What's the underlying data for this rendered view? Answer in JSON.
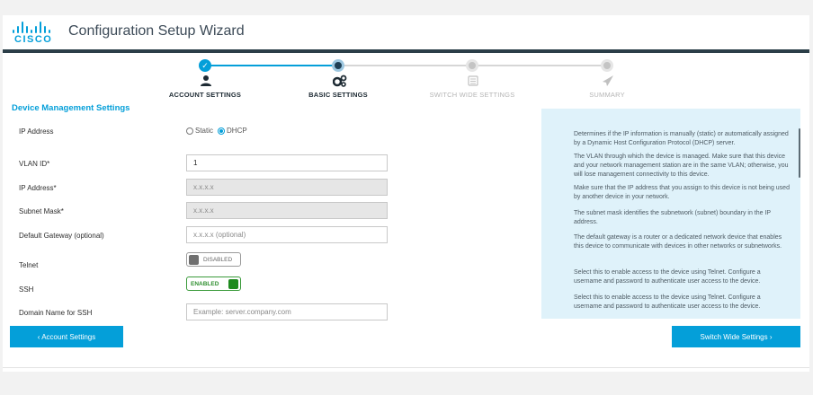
{
  "header": {
    "brand": "CISCO",
    "title": "Configuration Setup Wizard"
  },
  "steps": [
    {
      "label": "ACCOUNT SETTINGS",
      "state": "done",
      "icon": "user-icon"
    },
    {
      "label": "BASIC SETTINGS",
      "state": "current",
      "icon": "gears-icon"
    },
    {
      "label": "SWITCH WIDE SETTINGS",
      "state": "todo",
      "icon": "switch-icon"
    },
    {
      "label": "SUMMARY",
      "state": "todo",
      "icon": "paper-plane-icon"
    }
  ],
  "section": {
    "title": "Device Management Settings"
  },
  "form": {
    "ip_address_mode": {
      "label": "IP Address",
      "options": [
        "Static",
        "DHCP"
      ],
      "selected": "DHCP"
    },
    "vlan_id": {
      "label": "VLAN ID*",
      "value": "1"
    },
    "ip_address": {
      "label": "IP Address*",
      "placeholder": "x.x.x.x"
    },
    "subnet_mask": {
      "label": "Subnet Mask*",
      "placeholder": "x.x.x.x"
    },
    "default_gateway": {
      "label": "Default Gateway (optional)",
      "placeholder": "x.x.x.x (optional)"
    },
    "telnet": {
      "label": "Telnet",
      "state": "DISABLED"
    },
    "ssh": {
      "label": "SSH",
      "state": "ENABLED"
    },
    "domain_name_ssh": {
      "label": "Domain Name for SSH",
      "placeholder": "Example: server.company.com"
    }
  },
  "help": [
    "Determines if the IP information is manually (static) or automatically assigned by a Dynamic Host Configuration Protocol (DHCP) server.",
    "The VLAN through which the device is managed. Make sure that this device and your network management station are in the same VLAN; otherwise, you will lose management connectivity to this device.",
    "Make sure that the IP address that you assign to this device is not being used by another device in your network.",
    "The subnet mask identifies the subnetwork (subnet) boundary in the IP address.",
    "The default gateway is a router or a dedicated network device that enables this device to communicate with devices in other networks or subnetworks.",
    "Select this to enable access to the device using Telnet. Configure a username and password to authenticate user access to the device.",
    "Select this to enable access to the device using Telnet. Configure a username and password to authenticate user access to the device."
  ],
  "nav": {
    "back_label": "‹ Account Settings",
    "next_label": "Switch Wide Settings ›"
  },
  "colors": {
    "accent": "#049fd9",
    "header_bar": "#2b3e48",
    "help_bg": "#dff2fa",
    "enabled_green": "#1f8a1f"
  }
}
